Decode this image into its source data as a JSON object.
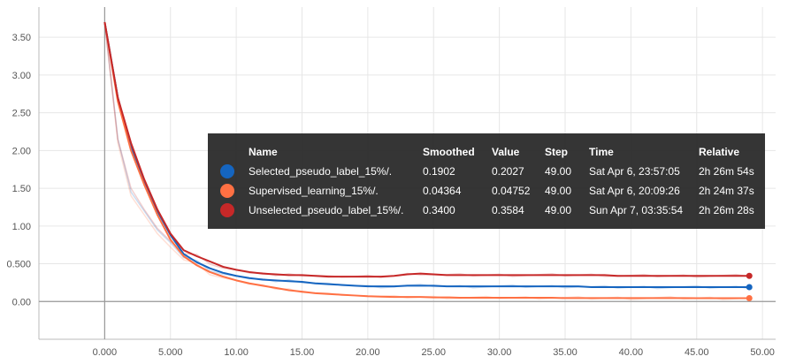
{
  "chart_data": {
    "type": "line",
    "xlim": [
      -5,
      51
    ],
    "ylim": [
      -0.5,
      3.9
    ],
    "x_ticks": [
      "0.000",
      "5.000",
      "10.00",
      "15.00",
      "20.00",
      "25.00",
      "30.00",
      "35.00",
      "40.00",
      "45.00",
      "50.00"
    ],
    "y_ticks": [
      "0.00",
      "0.500",
      "1.00",
      "1.50",
      "2.00",
      "2.50",
      "3.00",
      "3.50"
    ],
    "x_tick_values": [
      0,
      5,
      10,
      15,
      20,
      25,
      30,
      35,
      40,
      45,
      50
    ],
    "y_tick_values": [
      0,
      0.5,
      1,
      1.5,
      2,
      2.5,
      3,
      3.5
    ],
    "grid": true,
    "x": [
      0,
      1,
      2,
      3,
      4,
      5,
      6,
      7,
      8,
      9,
      10,
      11,
      12,
      13,
      14,
      15,
      16,
      17,
      18,
      19,
      20,
      21,
      22,
      23,
      24,
      25,
      26,
      27,
      28,
      29,
      30,
      31,
      32,
      33,
      34,
      35,
      36,
      37,
      38,
      39,
      40,
      41,
      42,
      43,
      44,
      45,
      46,
      47,
      48,
      49
    ],
    "series": [
      {
        "name": "Selected_pseudo_label_15%/.",
        "color": "#1565c0",
        "values": [
          3.7,
          2.7,
          2.05,
          1.6,
          1.2,
          0.88,
          0.63,
          0.52,
          0.44,
          0.38,
          0.34,
          0.31,
          0.29,
          0.28,
          0.27,
          0.26,
          0.24,
          0.23,
          0.22,
          0.21,
          0.2,
          0.2,
          0.2,
          0.21,
          0.21,
          0.21,
          0.2,
          0.2,
          0.2,
          0.2,
          0.2,
          0.2,
          0.2,
          0.2,
          0.2,
          0.2,
          0.2,
          0.19,
          0.19,
          0.19,
          0.19,
          0.19,
          0.19,
          0.19,
          0.19,
          0.19,
          0.19,
          0.19,
          0.19,
          0.19
        ]
      },
      {
        "name": "Supervised_learning_15%/.",
        "color": "#ff7043",
        "values": [
          3.7,
          2.65,
          2.0,
          1.55,
          1.15,
          0.82,
          0.6,
          0.48,
          0.39,
          0.33,
          0.28,
          0.24,
          0.21,
          0.18,
          0.15,
          0.13,
          0.11,
          0.1,
          0.09,
          0.08,
          0.07,
          0.065,
          0.06,
          0.06,
          0.06,
          0.055,
          0.055,
          0.05,
          0.05,
          0.05,
          0.05,
          0.05,
          0.05,
          0.05,
          0.05,
          0.045,
          0.045,
          0.045,
          0.045,
          0.045,
          0.045,
          0.045,
          0.045,
          0.045,
          0.045,
          0.044,
          0.044,
          0.044,
          0.044,
          0.044
        ]
      },
      {
        "name": "Unselected_pseudo_label_15%/.",
        "color": "#c62828",
        "values": [
          3.7,
          2.7,
          2.1,
          1.62,
          1.22,
          0.9,
          0.68,
          0.6,
          0.53,
          0.46,
          0.42,
          0.39,
          0.37,
          0.36,
          0.35,
          0.35,
          0.34,
          0.33,
          0.33,
          0.33,
          0.33,
          0.33,
          0.34,
          0.36,
          0.37,
          0.36,
          0.35,
          0.35,
          0.35,
          0.35,
          0.35,
          0.35,
          0.35,
          0.35,
          0.35,
          0.35,
          0.35,
          0.35,
          0.35,
          0.34,
          0.34,
          0.34,
          0.34,
          0.34,
          0.34,
          0.34,
          0.34,
          0.34,
          0.34,
          0.34
        ]
      }
    ]
  },
  "tooltip": {
    "headers": {
      "name": "Name",
      "smoothed": "Smoothed",
      "value": "Value",
      "step": "Step",
      "time": "Time",
      "relative": "Relative"
    },
    "rows": [
      {
        "name": "Selected_pseudo_label_15%/.",
        "smoothed": "0.1902",
        "value": "0.2027",
        "step": "49.00",
        "time": "Sat Apr 6, 23:57:05",
        "relative": "2h 26m 54s",
        "color": "#1565c0"
      },
      {
        "name": "Supervised_learning_15%/.",
        "smoothed": "0.04364",
        "value": "0.04752",
        "step": "49.00",
        "time": "Sat Apr 6, 20:09:26",
        "relative": "2h 24m 37s",
        "color": "#ff7043"
      },
      {
        "name": "Unselected_pseudo_label_15%/.",
        "smoothed": "0.3400",
        "value": "0.3584",
        "step": "49.00",
        "time": "Sun Apr 7, 03:35:54",
        "relative": "2h 26m 28s",
        "color": "#c62828"
      }
    ]
  }
}
